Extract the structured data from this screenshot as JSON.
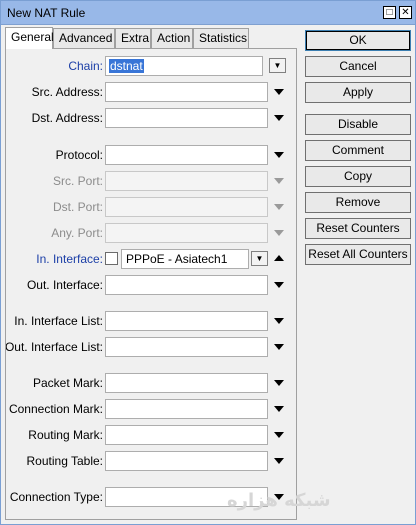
{
  "window": {
    "title": "New NAT Rule"
  },
  "tabs": [
    "General",
    "Advanced",
    "Extra",
    "Action",
    "Statistics"
  ],
  "fields": {
    "chain": {
      "label": "Chain:",
      "value": "dstnat"
    },
    "src_address": {
      "label": "Src. Address:"
    },
    "dst_address": {
      "label": "Dst. Address:"
    },
    "protocol": {
      "label": "Protocol:"
    },
    "src_port": {
      "label": "Src. Port:"
    },
    "dst_port": {
      "label": "Dst. Port:"
    },
    "any_port": {
      "label": "Any. Port:"
    },
    "in_interface": {
      "label": "In. Interface:",
      "value": "PPPoE - Asiatech1"
    },
    "out_interface": {
      "label": "Out. Interface:"
    },
    "in_interface_list": {
      "label": "In. Interface List:"
    },
    "out_interface_list": {
      "label": "Out. Interface List:"
    },
    "packet_mark": {
      "label": "Packet Mark:"
    },
    "connection_mark": {
      "label": "Connection Mark:"
    },
    "routing_mark": {
      "label": "Routing Mark:"
    },
    "routing_table": {
      "label": "Routing Table:"
    },
    "connection_type": {
      "label": "Connection Type:"
    }
  },
  "buttons": {
    "ok": "OK",
    "cancel": "Cancel",
    "apply": "Apply",
    "disable": "Disable",
    "comment": "Comment",
    "copy": "Copy",
    "remove": "Remove",
    "reset_counters": "Reset Counters",
    "reset_all_counters": "Reset All Counters"
  },
  "watermark": "شبکه هزاره"
}
